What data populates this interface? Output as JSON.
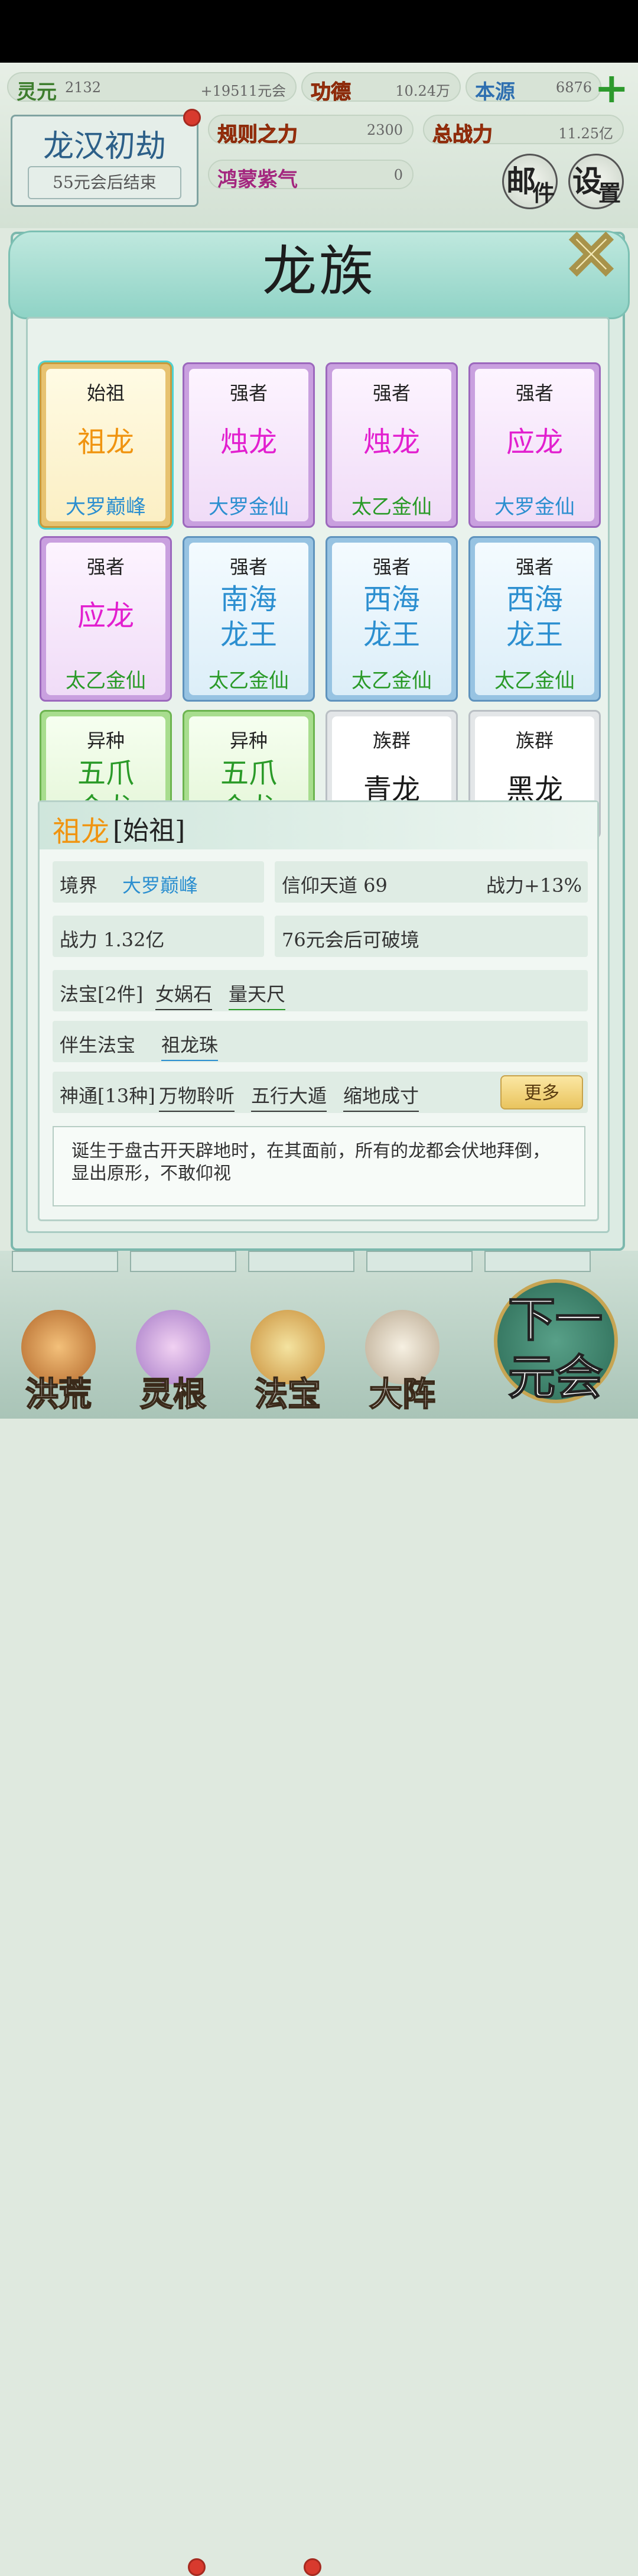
{
  "resources": {
    "lingyuan": {
      "label": "灵元",
      "value": "2132"
    },
    "income": "+19511元会",
    "gongde": {
      "label": "功德",
      "value": "10.24万"
    },
    "benyuan": {
      "label": "本源",
      "value": "6876"
    },
    "guize": {
      "label": "规则之力",
      "value": "2300"
    },
    "zongzhanli": {
      "label": "总战力",
      "value": "11.25亿"
    },
    "hongmeng": {
      "label": "鸿蒙紫气",
      "value": "0"
    }
  },
  "era": {
    "title": "龙汉初劫",
    "subtitle": "55元会后结束"
  },
  "buttons": {
    "mail": {
      "g1": "邮",
      "g2": "件"
    },
    "settings": {
      "g1": "设",
      "g2": "置"
    }
  },
  "modal": {
    "title": "龙族",
    "close": "✕"
  },
  "cards": [
    {
      "title": "始祖",
      "name": [
        "祖龙"
      ],
      "realm": "大罗巅峰",
      "style": "gold",
      "nameColor": "orange",
      "realmColor": "blue",
      "selected": true
    },
    {
      "title": "强者",
      "name": [
        "烛龙"
      ],
      "realm": "大罗金仙",
      "style": "purple",
      "nameColor": "magenta",
      "realmColor": "blue"
    },
    {
      "title": "强者",
      "name": [
        "烛龙"
      ],
      "realm": "太乙金仙",
      "style": "purple",
      "nameColor": "magenta",
      "realmColor": "green"
    },
    {
      "title": "强者",
      "name": [
        "应龙"
      ],
      "realm": "大罗金仙",
      "style": "purple",
      "nameColor": "magenta",
      "realmColor": "blue"
    },
    {
      "title": "强者",
      "name": [
        "应龙"
      ],
      "realm": "太乙金仙",
      "style": "purple",
      "nameColor": "magenta",
      "realmColor": "green"
    },
    {
      "title": "强者",
      "name": [
        "南海",
        "龙王"
      ],
      "realm": "太乙金仙",
      "style": "blue",
      "nameColor": "blue",
      "realmColor": "green"
    },
    {
      "title": "强者",
      "name": [
        "西海",
        "龙王"
      ],
      "realm": "太乙金仙",
      "style": "blue",
      "nameColor": "blue",
      "realmColor": "green"
    },
    {
      "title": "强者",
      "name": [
        "西海",
        "龙王"
      ],
      "realm": "太乙金仙",
      "style": "blue",
      "nameColor": "blue",
      "realmColor": "green"
    },
    {
      "title": "异种",
      "name": [
        "五爪",
        "金龙"
      ],
      "realm": "",
      "style": "green",
      "nameColor": "green",
      "realmColor": "green"
    },
    {
      "title": "异种",
      "name": [
        "五爪",
        "金龙"
      ],
      "realm": "",
      "style": "green",
      "nameColor": "green",
      "realmColor": "green"
    },
    {
      "title": "族群",
      "name": [
        "青龙"
      ],
      "realm": "",
      "style": "white",
      "nameColor": "black",
      "realmColor": "green"
    },
    {
      "title": "族群",
      "name": [
        "黑龙"
      ],
      "realm": "",
      "style": "white",
      "nameColor": "black",
      "realmColor": "green"
    }
  ],
  "detail": {
    "name": "祖龙",
    "rank": "[始祖]",
    "realm_label": "境界",
    "realm_value": "大罗巅峰",
    "faith": "信仰天道 69",
    "power_bonus": "战力+13%",
    "power": "战力 1.32亿",
    "breakthrough": "76元会后可破境",
    "treasure_label": "法宝[2件]",
    "treasures": [
      "女娲石",
      "量天尺"
    ],
    "companion_label": "伴生法宝",
    "companion": "祖龙珠",
    "skills_label": "神通[13种]",
    "skills": [
      "万物聆听",
      "五行大遁",
      "缩地成寸"
    ],
    "more": "更多",
    "description": "诞生于盘古开天辟地时，在其面前，所有的龙都会伏地拜倒，显出原形，不敢仰视"
  },
  "nav": [
    {
      "label": "洪荒",
      "icon": "mountain-flame-icon"
    },
    {
      "label": "灵根",
      "icon": "lotus-icon"
    },
    {
      "label": "法宝",
      "icon": "treasure-orb-icon"
    },
    {
      "label": "大阵",
      "icon": "yin-yang-icon"
    }
  ],
  "next_era": {
    "l1": "下一",
    "l2": "元会"
  },
  "colors": {
    "orange": "#f09410",
    "magenta": "#e21fcf",
    "blue": "#2c8fd0",
    "green": "#2a9a28"
  }
}
